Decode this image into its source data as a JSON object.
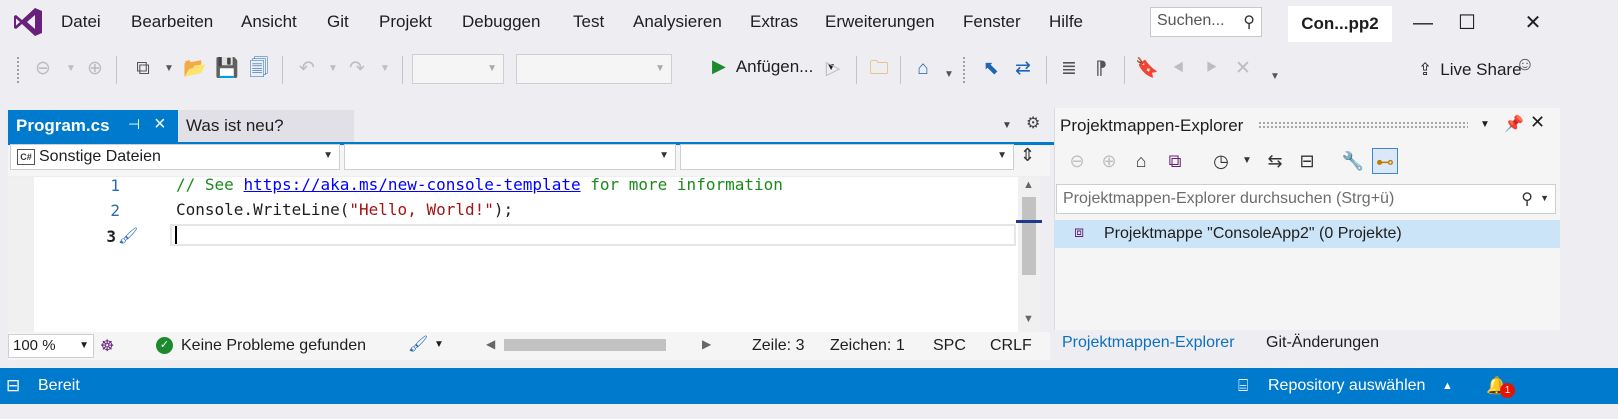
{
  "colors": {
    "accent": "#007acc",
    "vs_purple": "#68217a",
    "run_green": "#1d8a2e",
    "comment_green": "#1a8b1a",
    "string_red": "#a31515",
    "link_blue": "#0000ff"
  },
  "menu": {
    "items": [
      "Datei",
      "Bearbeiten",
      "Ansicht",
      "Git",
      "Projekt",
      "Debuggen",
      "Test",
      "Analysieren",
      "Extras",
      "Erweiterungen",
      "Fenster",
      "Hilfe"
    ],
    "search_placeholder": "Suchen...",
    "solution_title": "Con...pp2"
  },
  "toolbar": {
    "run_label": "Anfügen...",
    "liveshare_label": "Live Share"
  },
  "editor": {
    "tabs": [
      {
        "label": "Program.cs",
        "active": true
      },
      {
        "label": "Was ist neu?",
        "active": false
      }
    ],
    "nav": {
      "scope": "Sonstige Dateien",
      "scope_icon": "C#",
      "type": "",
      "member": ""
    },
    "lines": [
      {
        "num": "1",
        "comment_prefix": "// See ",
        "link": "https://aka.ms/new-console-template",
        "comment_suffix": " for more information"
      },
      {
        "num": "2",
        "code_prefix": "Console.WriteLine(",
        "string": "\"Hello, World!\"",
        "code_suffix": ");"
      },
      {
        "num": "3"
      }
    ],
    "status": {
      "zoom": "100 %",
      "problems": "Keine Probleme gefunden",
      "line": "Zeile: 3",
      "char": "Zeichen: 1",
      "whitespace": "SPC",
      "line_ending": "CRLF"
    }
  },
  "solution_explorer": {
    "title": "Projektmappen-Explorer",
    "search_placeholder": "Projektmappen-Explorer durchsuchen (Strg+ü)",
    "item": "Projektmappe \"ConsoleApp2\" (0 Projekte)",
    "bottom_tabs": [
      "Projektmappen-Explorer",
      "Git-Änderungen"
    ]
  },
  "statusbar": {
    "ready": "Bereit",
    "repository": "Repository auswählen",
    "notifications": "1"
  }
}
